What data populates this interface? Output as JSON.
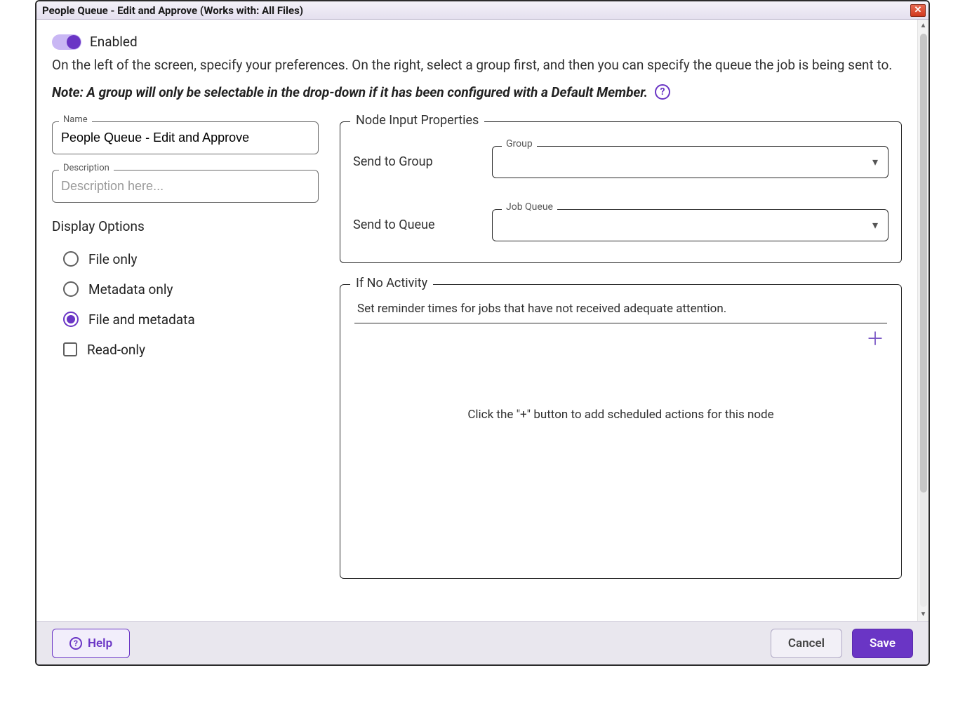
{
  "window": {
    "title": "People Queue - Edit and Approve (Works with: All Files)"
  },
  "header": {
    "enabled_label": "Enabled",
    "enabled_on": true,
    "intro": "On the left of the screen, specify your preferences. On the right, select a group first, and then you can specify the queue the job is being sent to.",
    "note": "Note: A group will only be selectable in the drop-down if it has been configured with a Default Member."
  },
  "left": {
    "name_label": "Name",
    "name_value": "People Queue - Edit and Approve",
    "description_label": "Description",
    "description_placeholder": "Description here...",
    "description_value": "",
    "display_section": "Display Options",
    "options": {
      "file_only": "File only",
      "metadata_only": "Metadata only",
      "file_and_metadata": "File and metadata",
      "read_only": "Read-only"
    },
    "selected": "file_and_metadata"
  },
  "right": {
    "node_group_legend": "Node Input Properties",
    "send_group_label": "Send to Group",
    "group_field_label": "Group",
    "group_value": "",
    "send_queue_label": "Send to Queue",
    "queue_field_label": "Job Queue",
    "queue_value": "",
    "activity_legend": "If No Activity",
    "activity_desc": "Set reminder times for jobs that have not received adequate attention.",
    "activity_placeholder": "Click the \"+\" button to add scheduled actions for this node"
  },
  "footer": {
    "help": "Help",
    "cancel": "Cancel",
    "save": "Save"
  },
  "icons": {
    "question": "?",
    "close": "✕",
    "chevron_down": "▾",
    "plus": "＋",
    "scroll_up": "▲",
    "scroll_down": "▼"
  }
}
